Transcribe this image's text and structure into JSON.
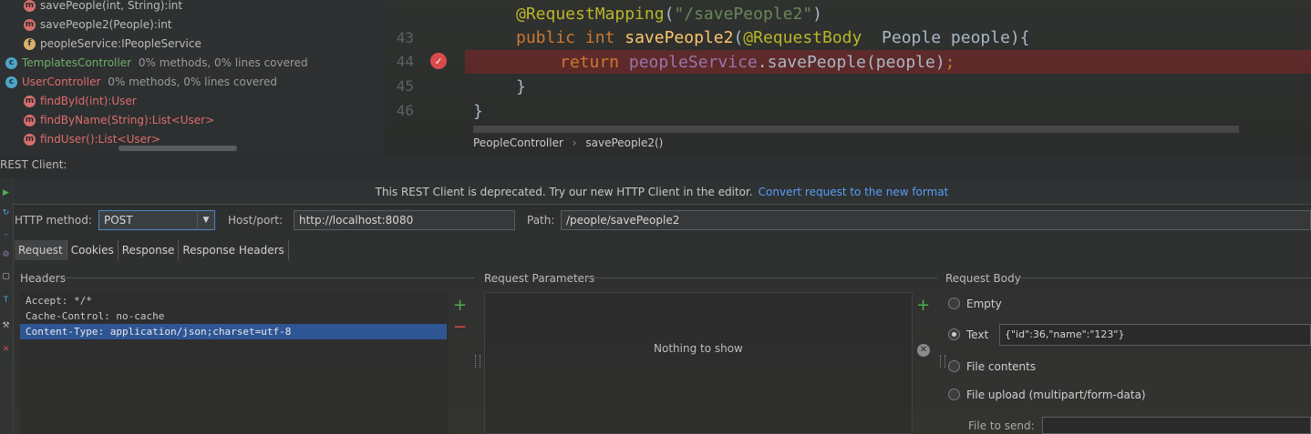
{
  "structure": {
    "items": [
      {
        "icon": "m",
        "text": "savePeople(int, String):int",
        "color": "#bbbbbb"
      },
      {
        "icon": "m",
        "text": "savePeople2(People):int",
        "color": "#bbbbbb"
      },
      {
        "icon": "f",
        "text": "peopleService:IPeopleService",
        "color": "#bbbbbb"
      },
      {
        "icon": "c",
        "name": "TemplatesController",
        "coverage": "0% methods, 0% lines covered",
        "color": "#6fb06a"
      },
      {
        "icon": "c",
        "name": "UserController",
        "coverage": "0% methods, 0% lines covered",
        "color": "#e06c6c"
      },
      {
        "icon": "m",
        "text": "findById(int):User",
        "color": "#e06c6c"
      },
      {
        "icon": "m",
        "text": "findByName(String):List<User>",
        "color": "#e06c6c"
      },
      {
        "icon": "m",
        "text": "findUser():List<User>",
        "color": "#e06c6c"
      }
    ]
  },
  "editor": {
    "line_numbers": [
      "43",
      "44",
      "45",
      "46"
    ],
    "code": {
      "annotation_name": "@RequestMapping",
      "annotation_arg": "\"/savePeople2\"",
      "public_kw": "public",
      "int_kw": "int",
      "method": "savePeople2",
      "param_ann": "@RequestBody",
      "param_rest": "People people){",
      "return_kw": "return",
      "service_field": "peopleService",
      "call": ".savePeople(people)",
      "semicolon": ";",
      "close_inner": "}",
      "close_outer": "}"
    },
    "breadcrumb": [
      "PeopleController",
      "savePeople2()"
    ]
  },
  "rest_client": {
    "title": "REST Client:",
    "notice": "This REST Client is deprecated. Try our new HTTP Client in the editor.",
    "notice_link": "Convert request to the new format",
    "http_method_label": "HTTP method:",
    "http_method_value": "POST",
    "host_label": "Host/port:",
    "host_value": "http://localhost:8080",
    "path_label": "Path:",
    "path_value": "/people/savePeople2",
    "tabs": [
      "Request",
      "Cookies",
      "Response",
      "Response Headers"
    ],
    "headers_title": "Headers",
    "headers": [
      "Accept: */*",
      "Cache-Control: no-cache",
      "Content-Type: application/json;charset=utf-8"
    ],
    "params_title": "Request Parameters",
    "params_empty": "Nothing to show",
    "body_title": "Request Body",
    "body_options": {
      "empty": "Empty",
      "text": "Text",
      "file_contents": "File contents",
      "file_upload": "File upload (multipart/form-data)"
    },
    "body_text_value": "{\"id\":36,\"name\":\"123\"}",
    "file_to_send_label": "File to send:"
  }
}
